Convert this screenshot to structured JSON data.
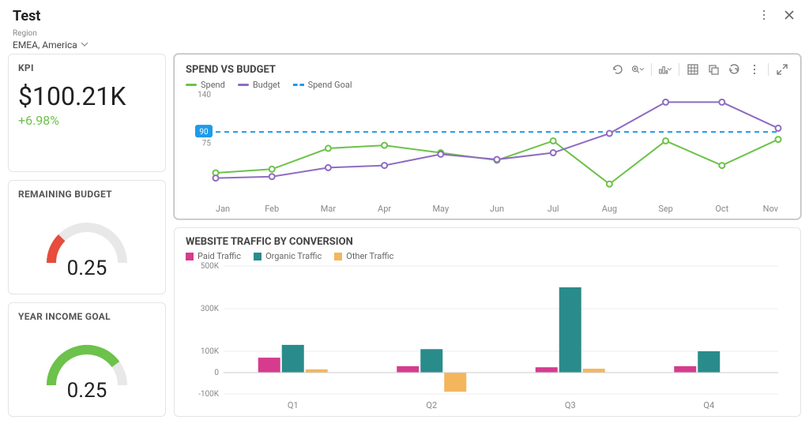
{
  "header": {
    "title": "Test",
    "filter_label": "Region",
    "filter_value": "EMEA, America"
  },
  "kpi": {
    "title": "KPI",
    "value": "$100.21K",
    "delta": "+6.98%"
  },
  "remaining_budget": {
    "title": "REMAINING BUDGET",
    "value": "0.25",
    "ratio": 0.25,
    "color": "#e74c3c"
  },
  "year_income_goal": {
    "title": "YEAR INCOME GOAL",
    "value": "0.25",
    "ratio": 0.8,
    "color": "#6cc24a"
  },
  "chart_data": [
    {
      "id": "spend_vs_budget",
      "type": "line",
      "title": "SPEND VS BUDGET",
      "categories": [
        "Jan",
        "Feb",
        "Mar",
        "Apr",
        "May",
        "Jun",
        "Jul",
        "Aug",
        "Sep",
        "Oct",
        "Nov"
      ],
      "series": [
        {
          "name": "Spend",
          "color": "#6cc24a",
          "values": [
            35,
            40,
            68,
            72,
            62,
            52,
            78,
            20,
            78,
            45,
            80
          ]
        },
        {
          "name": "Budget",
          "color": "#8e6cc2",
          "values": [
            28,
            30,
            42,
            45,
            60,
            53,
            62,
            88,
            130,
            130,
            95
          ]
        }
      ],
      "goal": {
        "name": "Spend Goal",
        "value": 90,
        "color": "#1e9be9"
      },
      "ylim": [
        0,
        140
      ],
      "yticks": [
        75,
        140
      ],
      "xlabel": "",
      "ylabel": ""
    },
    {
      "id": "website_traffic",
      "type": "bar",
      "title": "WEBSITE TRAFFIC BY CONVERSION",
      "categories": [
        "Q1",
        "Q2",
        "Q3",
        "Q4"
      ],
      "series": [
        {
          "name": "Paid Traffic",
          "color": "#d63b8e",
          "values": [
            70000,
            30000,
            25000,
            30000
          ]
        },
        {
          "name": "Organic Traffic",
          "color": "#2a8b8b",
          "values": [
            130000,
            110000,
            400000,
            100000
          ]
        },
        {
          "name": "Other Traffic",
          "color": "#f3b65c",
          "values": [
            15000,
            -90000,
            18000,
            0
          ]
        }
      ],
      "ylim": [
        -100000,
        500000
      ],
      "yticks": [
        -100000,
        0,
        100000,
        300000,
        500000
      ],
      "ytick_labels": [
        "-100K",
        "0",
        "100K",
        "300K",
        "500K"
      ],
      "xlabel": "",
      "ylabel": ""
    }
  ]
}
